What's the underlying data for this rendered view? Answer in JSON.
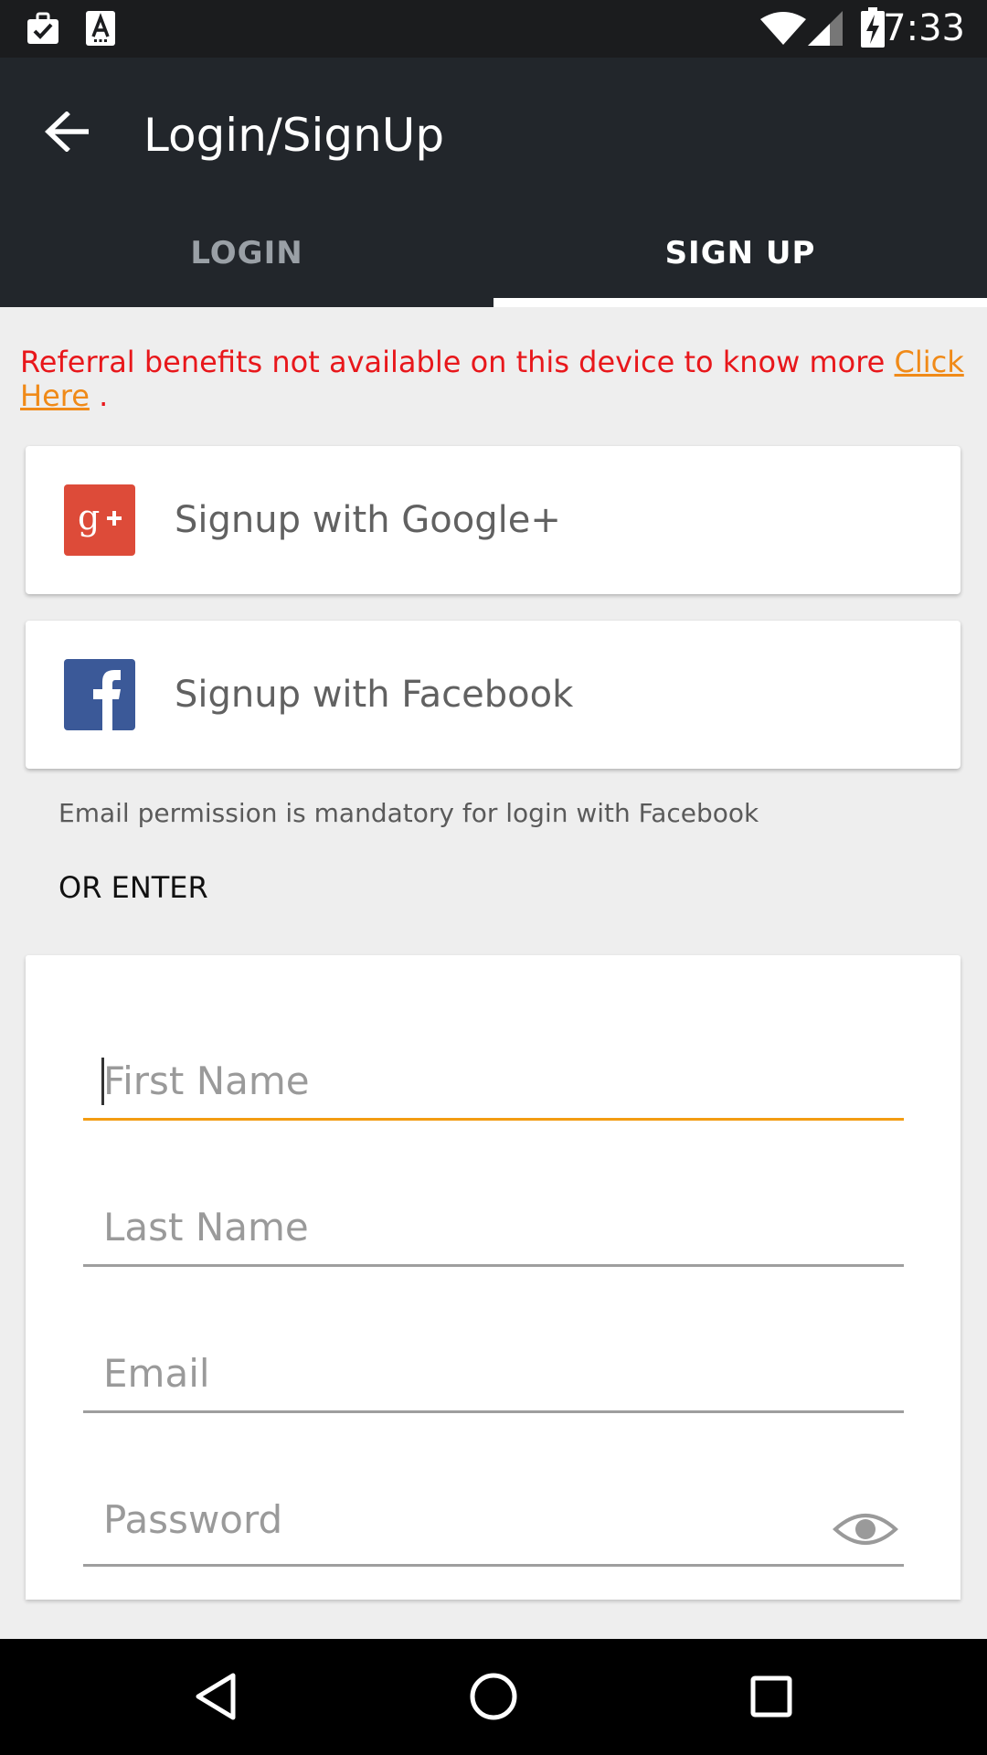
{
  "status_bar": {
    "time": "7:33",
    "icons": [
      "briefcase-check-icon",
      "font-a-icon",
      "wifi-icon",
      "cell-signal-icon",
      "battery-charging-icon"
    ]
  },
  "app_bar": {
    "title": "Login/SignUp",
    "back_icon": "arrow-left-icon"
  },
  "tabs": [
    {
      "label": "LOGIN",
      "active": false
    },
    {
      "label": "SIGN UP",
      "active": true
    }
  ],
  "referral": {
    "text": "Referral benefits not available on this device to know more ",
    "link_text_1": "Click",
    "link_text_2": "Here",
    "suffix": " ."
  },
  "social": {
    "google_label": "Signup with Google+",
    "facebook_label": "Signup with Facebook"
  },
  "facebook_note": "Email permission is mandatory for login with Facebook",
  "or_enter": "OR ENTER",
  "form": {
    "first_name": {
      "placeholder": "First Name",
      "value": ""
    },
    "last_name": {
      "placeholder": "Last Name",
      "value": ""
    },
    "email": {
      "placeholder": "Email",
      "value": ""
    },
    "password": {
      "placeholder": "Password",
      "value": ""
    }
  },
  "colors": {
    "app_bar": "#22262b",
    "status_bar": "#1b1c1e",
    "referral_text": "#e8171b",
    "link": "#f08a18",
    "focus_underline": "#f39c12",
    "google": "#dd4b39",
    "facebook": "#3b5998"
  },
  "nav_bar": {
    "icons": [
      "back-triangle-icon",
      "home-circle-icon",
      "recents-square-icon"
    ]
  }
}
